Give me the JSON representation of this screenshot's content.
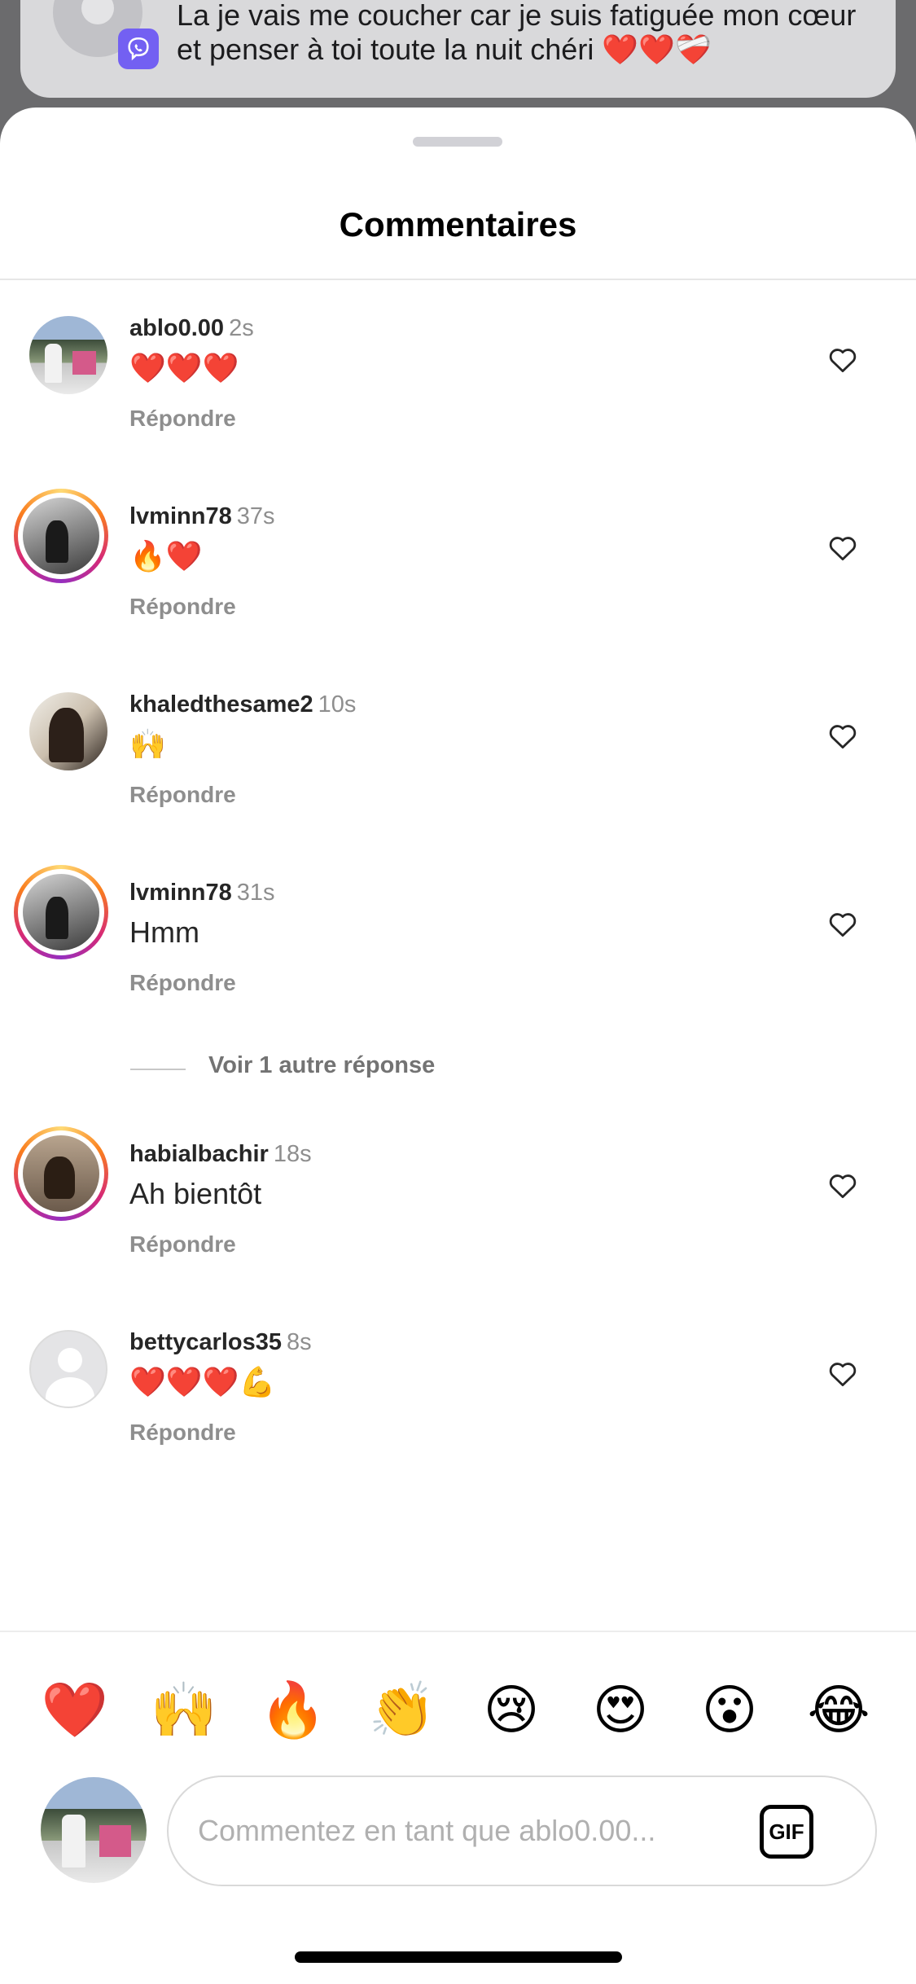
{
  "notification": {
    "message": "La je vais me coucher car je suis fatiguée mon cœur et penser à toi toute la nuit chéri ❤️❤️❤️‍🩹",
    "app_icon": "viber-icon"
  },
  "sheet": {
    "title": "Commentaires"
  },
  "comments": [
    {
      "username": "ablo0.00",
      "time": "2s",
      "text": "❤️❤️❤️",
      "reply_label": "Répondre",
      "avatar": "street-photo",
      "story_ring": false
    },
    {
      "username": "lvminn78",
      "time": "37s",
      "text": "🔥❤️",
      "reply_label": "Répondre",
      "avatar": "bw-photo",
      "story_ring": true
    },
    {
      "username": "khaledthesame2",
      "time": "10s",
      "text": "🙌",
      "reply_label": "Répondre",
      "avatar": "dark-photo",
      "story_ring": false
    },
    {
      "username": "lvminn78",
      "time": "31s",
      "text": "Hmm",
      "reply_label": "Répondre",
      "avatar": "bw-photo",
      "story_ring": true
    },
    {
      "username": "habialbachir",
      "time": "18s",
      "text": "Ah bientôt",
      "reply_label": "Répondre",
      "avatar": "room-photo",
      "story_ring": true
    },
    {
      "username": "bettycarlos35",
      "time": "8s",
      "text": "❤️❤️❤️💪",
      "reply_label": "Répondre",
      "avatar": "default-avatar",
      "story_ring": false
    }
  ],
  "more_replies": {
    "label": "Voir 1 autre réponse"
  },
  "quick_reactions": [
    "❤️",
    "🙌",
    "🔥",
    "👏",
    "😢",
    "😍",
    "😮",
    "😂"
  ],
  "composer": {
    "placeholder": "Commentez en tant que ablo0.00...",
    "value": "",
    "gif_label": "GIF"
  },
  "colors": {
    "like_outline": "#262626",
    "meta_gray": "#8e8e8e",
    "viber_purple": "#7360f2"
  }
}
